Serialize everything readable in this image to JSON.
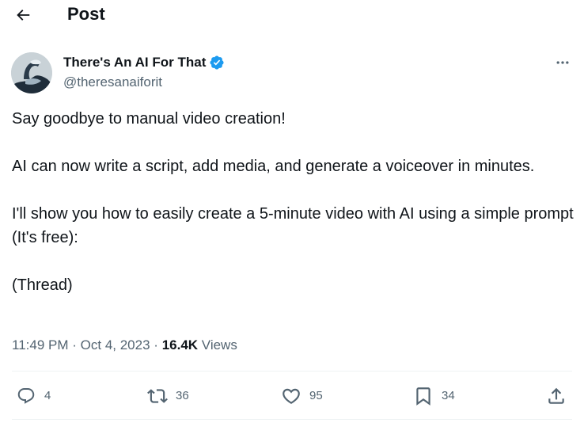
{
  "header": {
    "title": "Post",
    "back_icon": "arrow-left-icon"
  },
  "author": {
    "name": "There's An AI For That",
    "handle": "@theresanaiforit",
    "verified": true,
    "verified_color": "#1d9bf0",
    "avatar_icon": "robot-logo-icon"
  },
  "more_icon": "more-horizontal-icon",
  "tweet": {
    "paragraphs": [
      "Say goodbye to manual video creation!",
      "AI can now write a script, add media, and generate a voiceover in minutes.",
      "I'll show you how to easily create a 5-minute video with AI using a simple prompt (It's free):",
      "(Thread)"
    ]
  },
  "meta": {
    "time": "11:49 PM",
    "separator": "·",
    "date": "Oct 4, 2023",
    "views_count": "16.4K",
    "views_label": "Views"
  },
  "actions": {
    "replies": {
      "icon": "reply-icon",
      "count": "4"
    },
    "reposts": {
      "icon": "repost-icon",
      "count": "36"
    },
    "likes": {
      "icon": "heart-icon",
      "count": "95"
    },
    "bookmarks": {
      "icon": "bookmark-icon",
      "count": "34"
    },
    "share": {
      "icon": "share-icon"
    }
  },
  "colors": {
    "text_primary": "#0f1419",
    "text_secondary": "#536471",
    "divider": "#eff3f4",
    "accent": "#1d9bf0"
  }
}
